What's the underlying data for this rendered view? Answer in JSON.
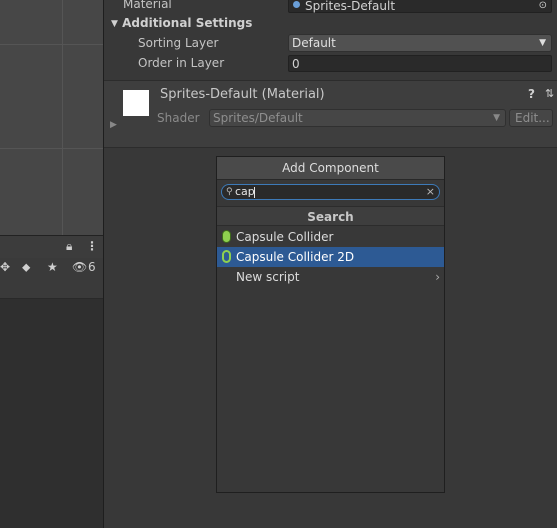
{
  "inspector": {
    "material_label": "Material",
    "material_value": "Sprites-Default",
    "additional_settings": "Additional Settings",
    "sorting_layer_label": "Sorting Layer",
    "sorting_layer_value": "Default",
    "order_in_layer_label": "Order in Layer",
    "order_in_layer_value": "0"
  },
  "material_section": {
    "title": "Sprites-Default (Material)",
    "shader_label": "Shader",
    "shader_value": "Sprites/Default",
    "edit_button": "Edit..."
  },
  "left_toolbar": {
    "hidden_count": "6"
  },
  "add_component_popup": {
    "title": "Add Component",
    "search_value": "cap",
    "section_title": "Search",
    "items": [
      {
        "label": "Capsule Collider",
        "icon": "capsule-collider-icon",
        "selected": false
      },
      {
        "label": "Capsule Collider 2D",
        "icon": "capsule-collider-2d-icon",
        "selected": true
      },
      {
        "label": "New script",
        "icon": "",
        "selected": false
      }
    ]
  },
  "colors": {
    "background": "#383838",
    "selection": "#2d5a94",
    "collider_green": "#8fd14f",
    "search_focus": "#3d7ab8"
  }
}
